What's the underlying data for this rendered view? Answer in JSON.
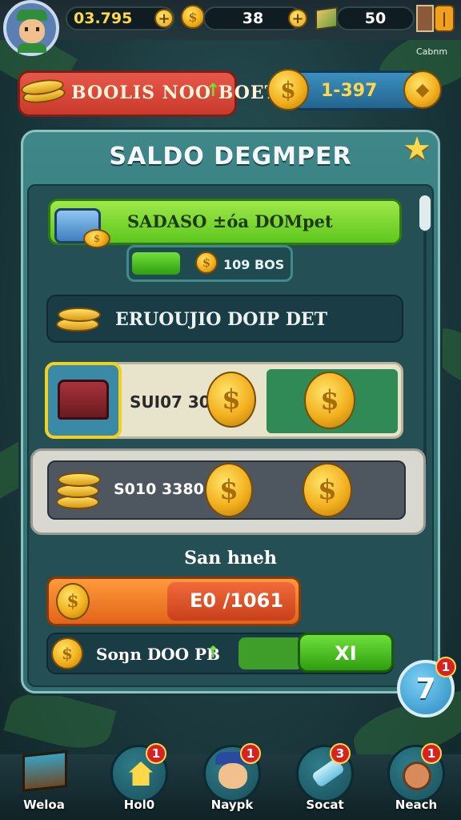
{
  "top_bar": {
    "currency_1": "03.795",
    "currency_2": "38",
    "currency_3": "50",
    "corner_label": "Cabnm"
  },
  "header": {
    "banner_label": "BOOLIS NOO BOET",
    "banner_arrow": "↑",
    "coin_value": "1-397"
  },
  "panel": {
    "title": "SALDO DEGMPER",
    "row1_label": "SADASO ±óa DOMpet",
    "row1_sub": "109 BOS",
    "row2_label": "ERUOUJIO DOIP DET",
    "row3_value": "SUI07 30",
    "row4_value": "S010 3380",
    "section_label": "San hneh",
    "orange_value": "E0 /1061",
    "green_row_label": "Soŋn DOO PB",
    "green_row_arrow": "↑",
    "green_button": "XI",
    "help_number": "7",
    "help_badge": "1"
  },
  "bottom_nav": [
    {
      "label": "Weloa",
      "badge": ""
    },
    {
      "label": "Hol0",
      "badge": "1"
    },
    {
      "label": "Naypk",
      "badge": "1"
    },
    {
      "label": "Socat",
      "badge": "3"
    },
    {
      "label": "Neach",
      "badge": "1"
    }
  ],
  "colors": {
    "panel": "#3e8688",
    "accent_gold": "#f2b01e",
    "green": "#5ec71e",
    "orange": "#f07a1e",
    "red": "#d9412b"
  }
}
